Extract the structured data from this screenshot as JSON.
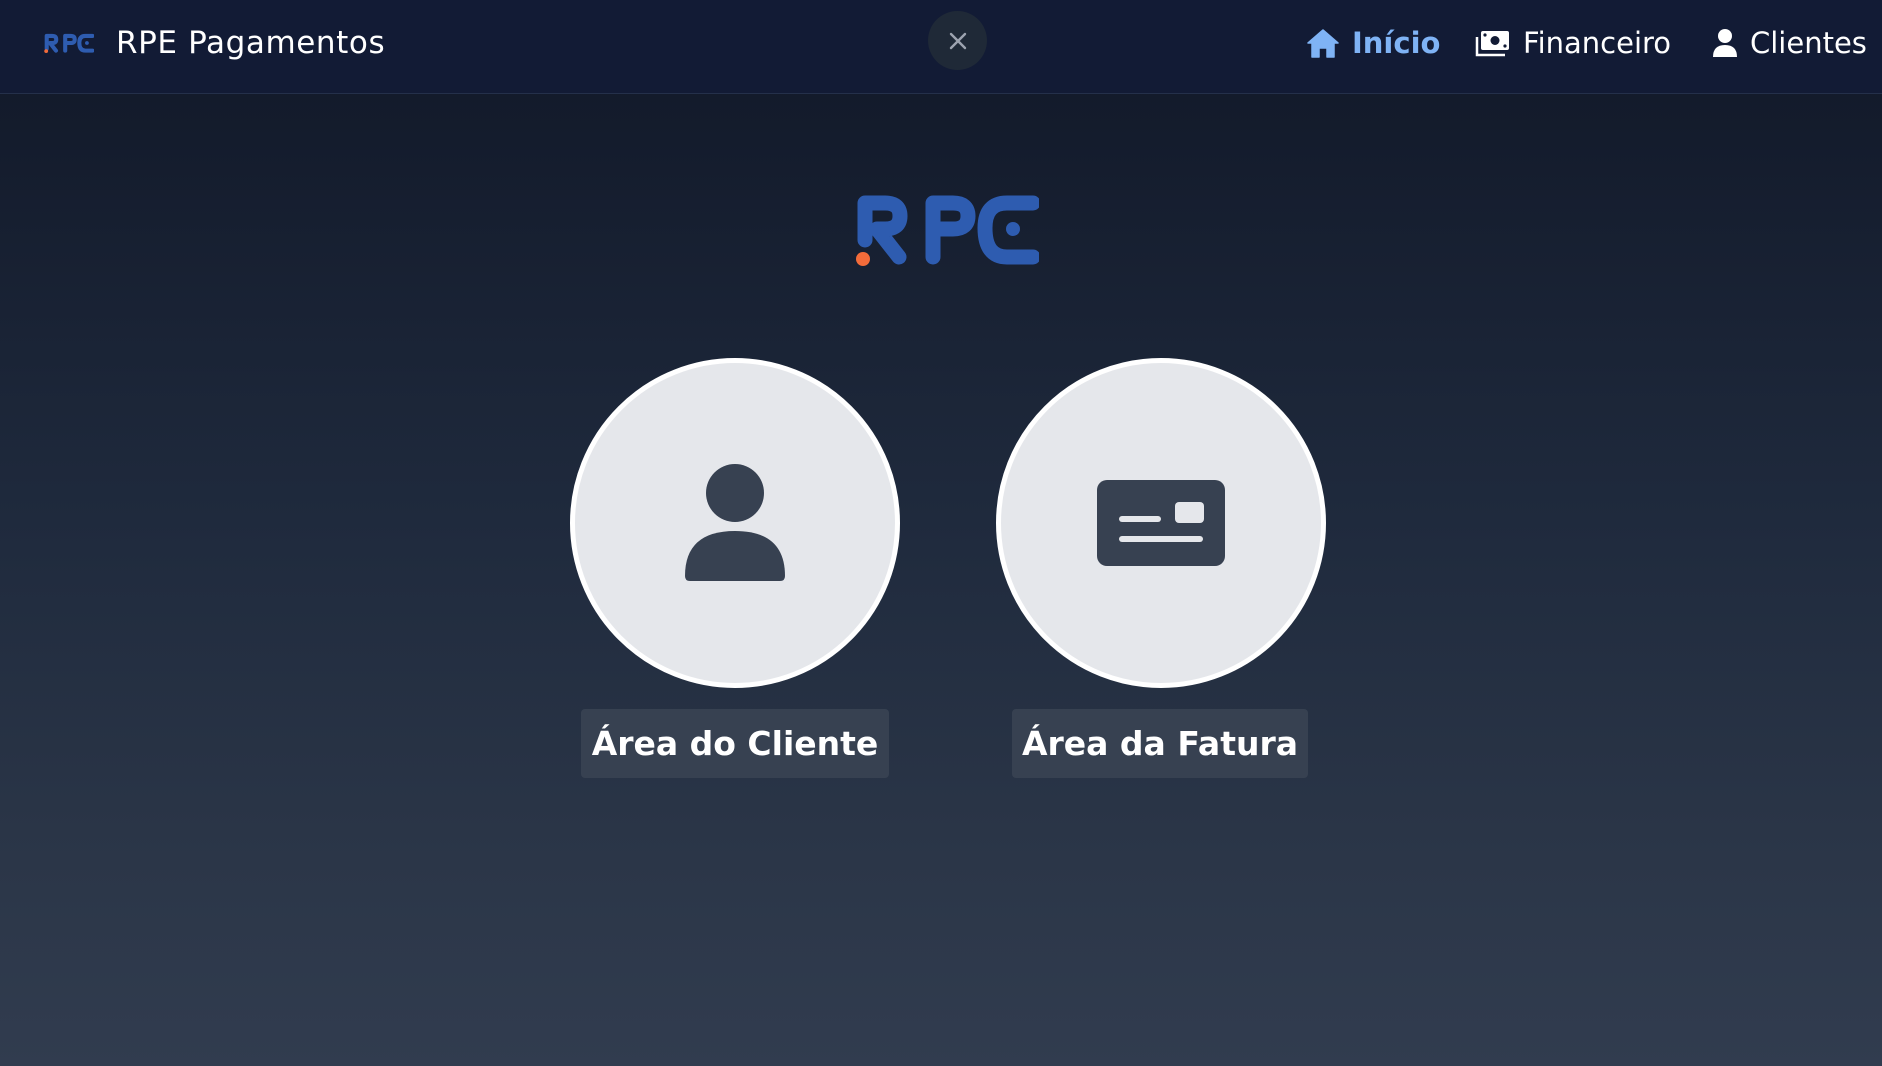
{
  "header": {
    "brand_name": "RPE Pagamentos",
    "logo_text": "RPE",
    "close_icon": "close-icon",
    "nav": [
      {
        "label": "Início",
        "icon": "home-icon",
        "active": true
      },
      {
        "label": "Financeiro",
        "icon": "money-bill-icon",
        "active": false
      },
      {
        "label": "Clientes",
        "icon": "user-icon",
        "active": false
      }
    ]
  },
  "main": {
    "logo_text": "RPE",
    "tiles": [
      {
        "label": "Área do Cliente",
        "icon": "user-icon"
      },
      {
        "label": "Área da Fatura",
        "icon": "id-card-icon"
      }
    ]
  },
  "colors": {
    "header_bg": "#121b35",
    "nav_active": "#7fb3f5",
    "logo_blue": "#2e5cb0",
    "logo_accent": "#f26b3a",
    "tile_bg": "#e5e7eb",
    "tile_icon": "#374151",
    "button_bg": "#374151"
  }
}
